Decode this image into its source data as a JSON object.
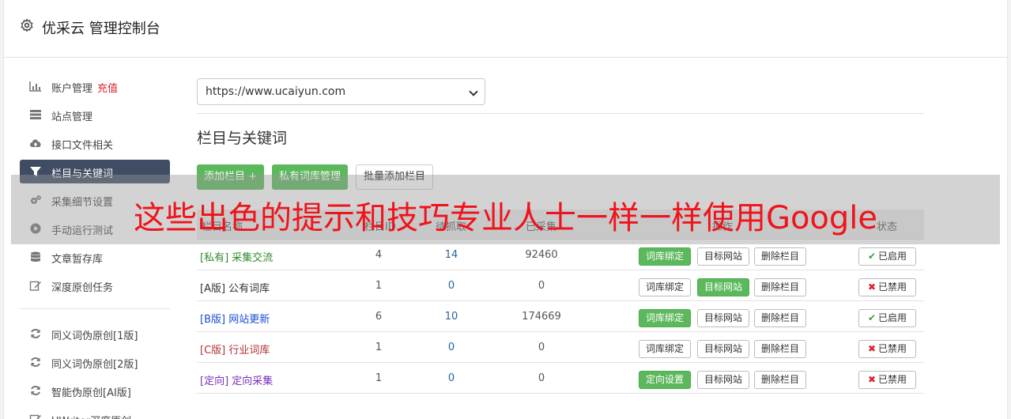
{
  "app": {
    "title": "优采云 管理控制台"
  },
  "sidebar": {
    "items": [
      {
        "label": "账户管理",
        "extra": "充值",
        "icon": "bar-chart-icon"
      },
      {
        "label": "站点管理",
        "icon": "server-icon"
      },
      {
        "label": "接口文件相关",
        "icon": "cloud-upload-icon"
      },
      {
        "label": "栏目与关键词",
        "icon": "filter-icon",
        "active": true
      },
      {
        "label": "采集细节设置",
        "icon": "gears-icon"
      },
      {
        "label": "手动运行测试",
        "icon": "play-circle-icon"
      },
      {
        "label": "文章暂存库",
        "icon": "database-icon"
      },
      {
        "label": "深度原创任务",
        "icon": "edit-icon"
      }
    ],
    "items2": [
      {
        "label": "同义词伪原创[1版]",
        "icon": "refresh-icon"
      },
      {
        "label": "同义词伪原创[2版]",
        "icon": "refresh-icon"
      },
      {
        "label": "智能伪原创[AI版]",
        "icon": "refresh-icon"
      },
      {
        "label": "UWriter深度原创",
        "icon": "edit-icon"
      }
    ]
  },
  "main": {
    "site_select": "https://www.ucaiyun.com",
    "section_title": "栏目与关键词",
    "buttons": {
      "add": "添加栏目 +",
      "private": "私有词库管理",
      "batch": "批量添加栏目"
    },
    "table": {
      "headers": {
        "name": "栏目名称",
        "id": "栏目ID",
        "fetch": "待抓取",
        "collected": "已采集",
        "ops": "操作",
        "status": "状态"
      },
      "rows": [
        {
          "tag": "[私有]",
          "name": "采集交流",
          "color": "#2e8b2e",
          "id": "4",
          "fetch": "14",
          "collected": "92460",
          "op1": "词库绑定",
          "op1_on": true,
          "op2": "目标网站",
          "op2_on": false,
          "op3": "删除栏目",
          "status": "已启用",
          "enabled": true
        },
        {
          "tag": "[A版]",
          "name": "公有词库",
          "color": "#333333",
          "id": "1",
          "fetch": "0",
          "collected": "0",
          "op1": "词库绑定",
          "op1_on": false,
          "op2": "目标网站",
          "op2_on": true,
          "op3": "删除栏目",
          "status": "已禁用",
          "enabled": false
        },
        {
          "tag": "[B版]",
          "name": "网站更新",
          "color": "#1a4dd6",
          "id": "6",
          "fetch": "10",
          "collected": "174669",
          "op1": "词库绑定",
          "op1_on": true,
          "op2": "目标网站",
          "op2_on": false,
          "op3": "删除栏目",
          "status": "已启用",
          "enabled": true
        },
        {
          "tag": "[C版]",
          "name": "行业词库",
          "color": "#b0303a",
          "id": "1",
          "fetch": "0",
          "collected": "0",
          "op1": "词库绑定",
          "op1_on": false,
          "op2": "目标网站",
          "op2_on": false,
          "op3": "删除栏目",
          "status": "已禁用",
          "enabled": false
        },
        {
          "tag": "[定向]",
          "name": "定向采集",
          "color": "#7a2fb8",
          "id": "1",
          "fetch": "0",
          "collected": "0",
          "op1": "定向设置",
          "op1_on": true,
          "op2": "目标网站",
          "op2_on": false,
          "op3": "删除栏目",
          "status": "已禁用",
          "enabled": false
        }
      ]
    }
  },
  "overlay": {
    "text": "这些出色的提示和技巧专业人士一样一样使用Google"
  }
}
